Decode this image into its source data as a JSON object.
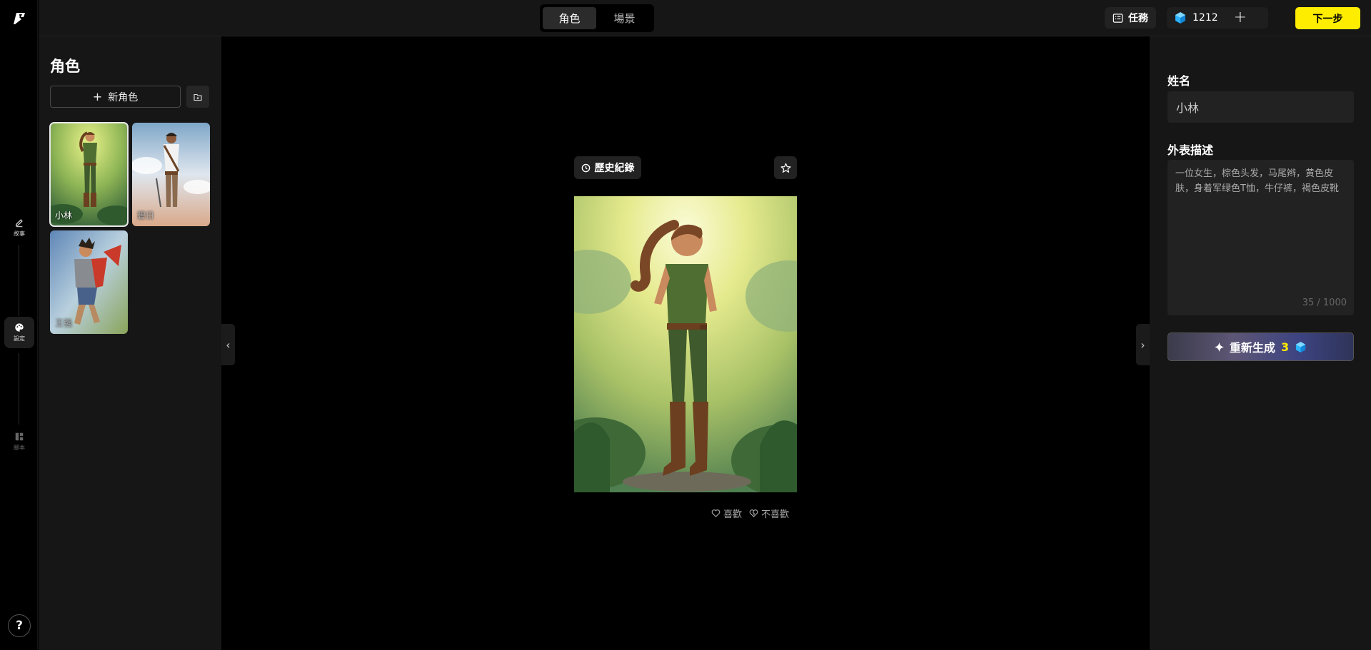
{
  "topbar": {
    "tabs": [
      {
        "label": "角色",
        "active": true
      },
      {
        "label": "場景",
        "active": false
      }
    ],
    "task_label": "任務",
    "credits": "1212",
    "next_label": "下一步"
  },
  "rail": {
    "items": [
      {
        "label": "故事",
        "icon": "pencil-icon"
      },
      {
        "label": "設定",
        "icon": "palette-icon",
        "active": true
      },
      {
        "label": "腳本",
        "icon": "storyboard-icon"
      }
    ],
    "help": "?"
  },
  "left_panel": {
    "title": "角色",
    "new_character": "新角色",
    "characters": [
      {
        "name": "小林",
        "selected": true
      },
      {
        "name": "碧日",
        "selected": false
      },
      {
        "name": "王强",
        "selected": false
      }
    ]
  },
  "canvas": {
    "history_label": "歷史紀錄",
    "like_label": "喜歡",
    "dislike_label": "不喜歡"
  },
  "right_panel": {
    "name_label": "姓名",
    "name_value": "小林",
    "desc_label": "外表描述",
    "desc_value": "一位女生，棕色头发，马尾辫，黄色皮肤，身着军绿色T恤，牛仔裤，褐色皮靴",
    "counter": "35 / 1000",
    "regen_label": "重新生成",
    "regen_cost": "3"
  },
  "colors": {
    "accent_yellow": "#ffed00",
    "credit_blue": "#2ab3ff",
    "panel_bg": "#161616"
  }
}
